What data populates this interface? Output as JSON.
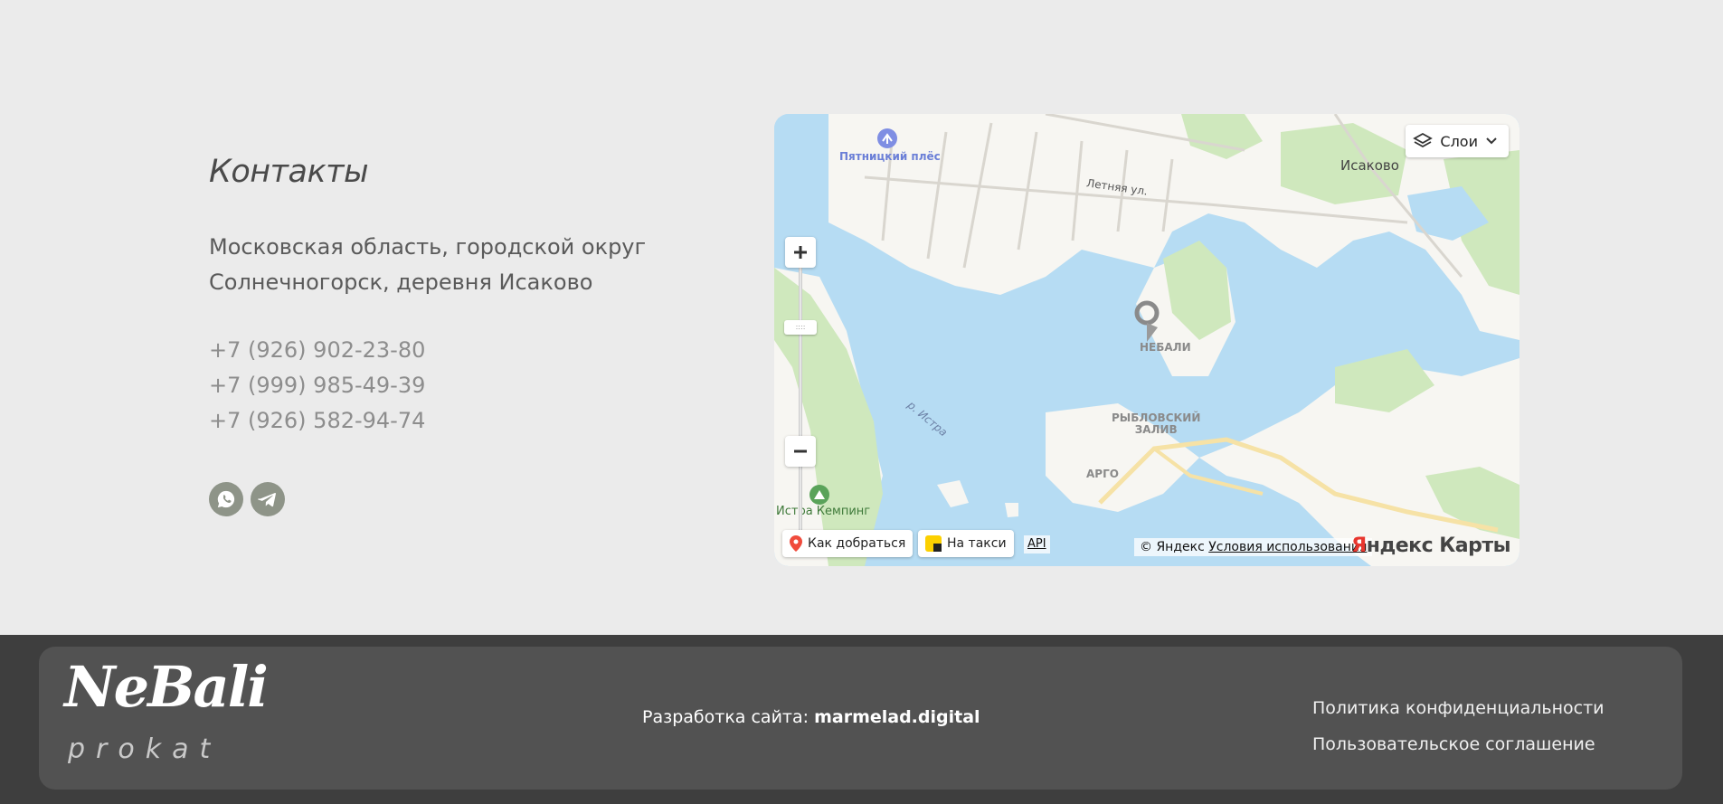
{
  "contacts": {
    "title": "Контакты",
    "address_line1": "Московская область, городской округ",
    "address_line2": "Солнечногорск, деревня Исаково",
    "phones": [
      "+7 (926) 902-23-80",
      "+7 (999) 985-49-39",
      "+7 (926) 582-94-74"
    ],
    "socials": [
      {
        "icon": "whatsapp-icon"
      },
      {
        "icon": "telegram-icon"
      }
    ]
  },
  "map": {
    "layers_label": "Слои",
    "labels": {
      "pyatnitsky": "Пятницкий плёс",
      "letnyaya": "Летняя ул.",
      "isakovo": "Исаково",
      "nebali": "НЕБАЛИ",
      "istra_river": "р. Истра",
      "rybl_1": "РЫБЛОВСКИЙ",
      "rybl_2": "ЗАЛИВ",
      "argo": "АРГО",
      "camping": "Истра Кемпинг"
    },
    "route_label": "Как добраться",
    "taxi_label": "На такси",
    "api_label": "API",
    "copyright": "© Яндекс",
    "terms_label": "Условия использования",
    "logo_ya": "Я",
    "logo_rest": "ндекс Карты"
  },
  "footer": {
    "logo_main": "NeBali",
    "logo_sub": "prokat",
    "dev_prefix": "Разработка сайта:",
    "dev_name": "marmelad.digital",
    "privacy": "Политика конфиденциальности",
    "agreement": "Пользовательское соглашение"
  }
}
